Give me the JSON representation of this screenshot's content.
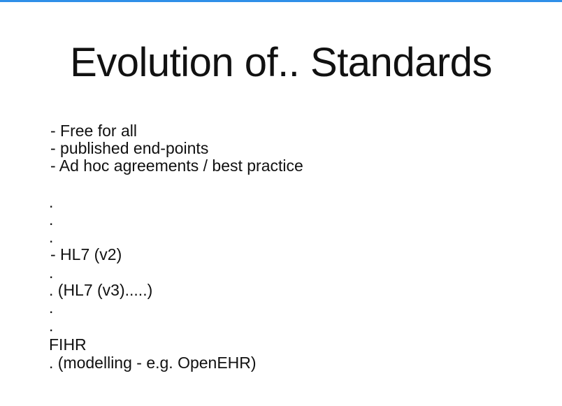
{
  "slide": {
    "title": "Evolution of.. Standards",
    "lines": [
      " - Free for all",
      " - published end-points",
      " - Ad hoc agreements / best practice",
      ".",
      ".",
      ".",
      " - HL7 (v2)",
      ".",
      ". (HL7 (v3).....)",
      ".",
      ".",
      "FIHR",
      ". (modelling - e.g. OpenEHR)"
    ]
  },
  "colors": {
    "accent_bar": "#2f8fe8",
    "background": "#ffffff",
    "text": "#111111"
  }
}
